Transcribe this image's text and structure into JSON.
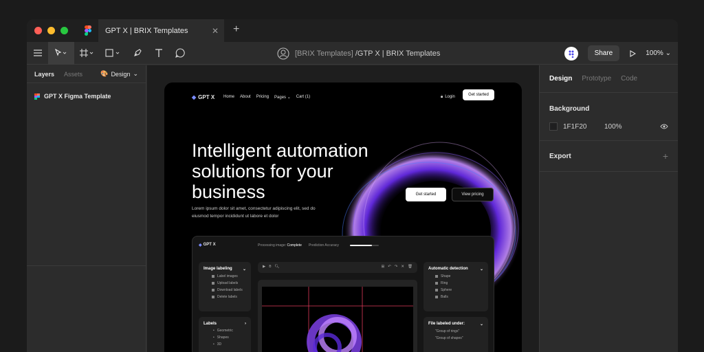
{
  "window": {
    "tab_title": "GPT X | BRIX Templates",
    "breadcrumb_team": "[BRIX Templates]",
    "breadcrumb_file": "/GTP X | BRIX Templates",
    "share_label": "Share",
    "zoom": "100%"
  },
  "left_panel": {
    "tab_layers": "Layers",
    "tab_assets": "Assets",
    "page_selector": "Design",
    "layer_name": "GPT X Figma Template"
  },
  "right_panel": {
    "tab_design": "Design",
    "tab_prototype": "Prototype",
    "tab_code": "Code",
    "background_title": "Background",
    "bg_color": "1F1F20",
    "bg_opacity": "100%",
    "export_title": "Export"
  },
  "site": {
    "logo": "GPT X",
    "nav": [
      "Home",
      "About",
      "Pricing",
      "Pages",
      "Cart (1)"
    ],
    "login": "Login",
    "get_started_nav": "Get started",
    "headline": "Intelligent automation solutions for your business",
    "subtext": "Lorem ipsum dolor sit amet, consectetur adipiscing elit, sed do eiusmod tempor incididunt ut labore et dolor",
    "cta_primary": "Get started",
    "cta_secondary": "View pricing"
  },
  "dashboard": {
    "logo": "GPT X",
    "processing_label": "Processing image:",
    "processing_value": "Complete",
    "accuracy_label": "Prediction Accuracy",
    "accuracy_progress": 0.75,
    "image_labeling": {
      "title": "Image labeling",
      "items": [
        "Label images",
        "Upload labels",
        "Download labels",
        "Delete labels"
      ]
    },
    "labels": {
      "title": "Labels",
      "items": [
        "Geometric",
        "Shapes",
        "3D"
      ]
    },
    "auto_detection": {
      "title": "Automatic detection",
      "items": [
        "Shape",
        "Ring",
        "Sphere",
        "Balls"
      ]
    },
    "file_labeled": {
      "title": "File labeled under:",
      "items": [
        "\"Group of rings\"",
        "\"Group of shapes\""
      ]
    }
  },
  "colors": {
    "accent": "#7b3fe4",
    "figma_red": "#f24e1e",
    "figma_purple": "#a259ff",
    "figma_blue": "#1abcfe",
    "figma_green": "#0acf83",
    "traffic_red": "#ff5f57",
    "traffic_yellow": "#febc2e",
    "traffic_green": "#28c840"
  }
}
